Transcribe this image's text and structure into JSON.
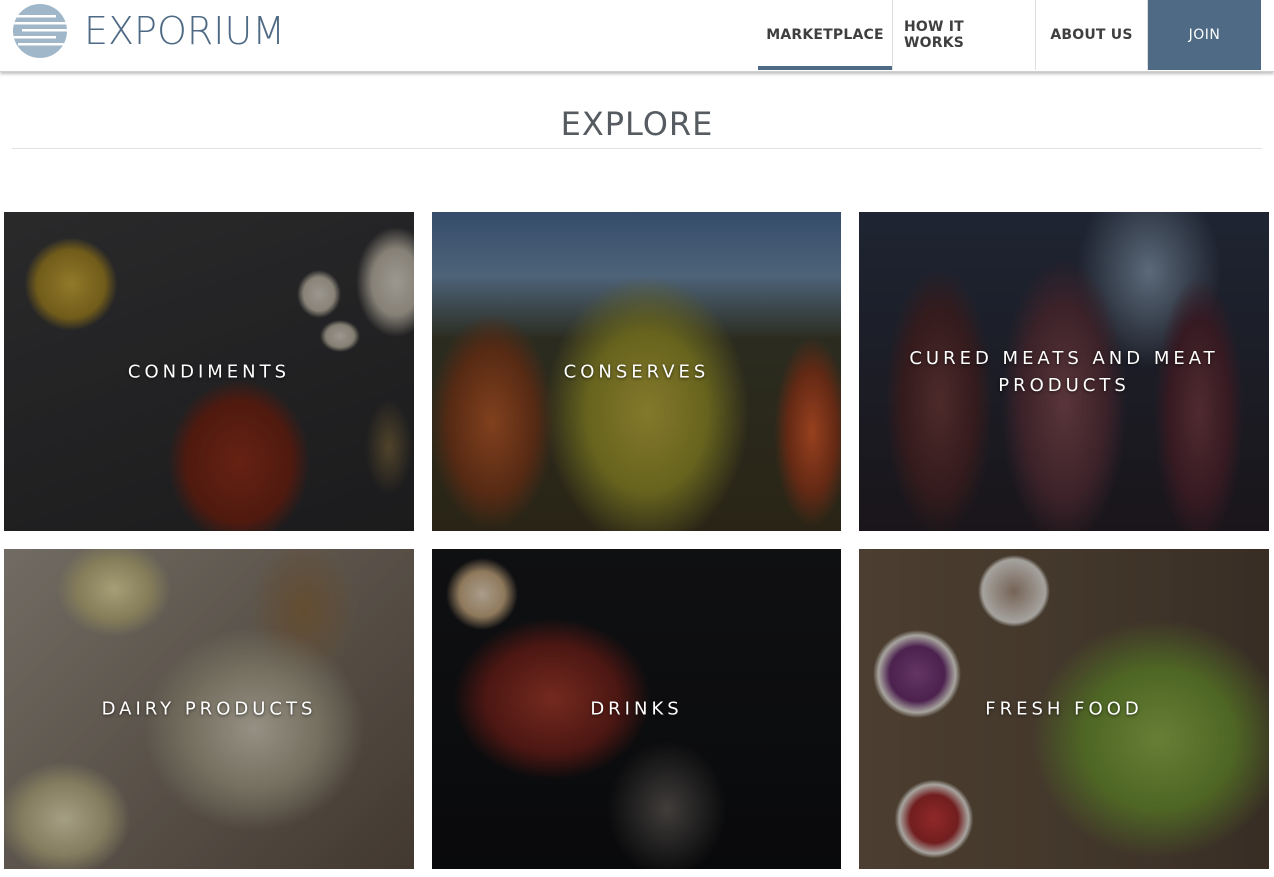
{
  "header": {
    "brand_name": "EXPORIUM",
    "nav": [
      {
        "label": "MARKETPLACE",
        "active": true
      },
      {
        "label": "HOW IT WORKS",
        "active": false
      },
      {
        "label": "ABOUT US",
        "active": false
      }
    ],
    "join_label": "JOIN"
  },
  "main": {
    "title": "EXPLORE",
    "categories": [
      {
        "label": "CONDIMENTS"
      },
      {
        "label": "CONSERVES"
      },
      {
        "label": "CURED MEATS AND MEAT PRODUCTS"
      },
      {
        "label": "DAIRY PRODUCTS"
      },
      {
        "label": "DRINKS"
      },
      {
        "label": "FRESH FOOD"
      }
    ]
  },
  "colors": {
    "brand": "#4e6a84",
    "nav_text": "#3f3f3f",
    "title_text": "#555b60"
  }
}
